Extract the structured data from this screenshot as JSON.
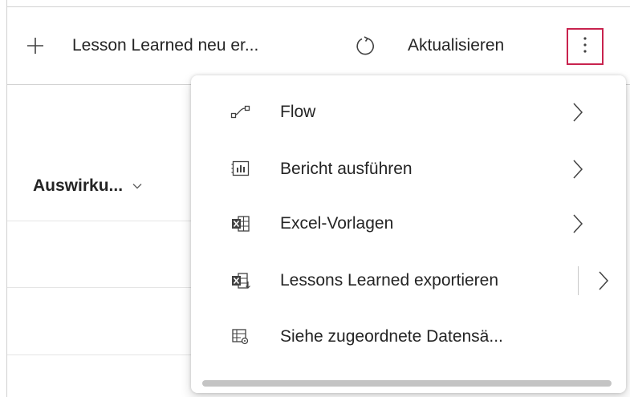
{
  "commandbar": {
    "new_label": "Lesson Learned neu er...",
    "refresh_label": "Aktualisieren"
  },
  "grid": {
    "column_header": "Auswirku..."
  },
  "menu": {
    "items": [
      {
        "label": "Flow",
        "icon": "flow-icon"
      },
      {
        "label": "Bericht ausführen",
        "icon": "report-icon"
      },
      {
        "label": "Excel-Vorlagen",
        "icon": "excel-templates-icon"
      },
      {
        "label": "Lessons Learned exportieren",
        "icon": "excel-export-icon"
      },
      {
        "label": "Siehe zugeordnete Datensä...",
        "icon": "related-records-icon"
      }
    ]
  },
  "colors": {
    "highlight_border": "#c8234e",
    "text": "#242424"
  }
}
